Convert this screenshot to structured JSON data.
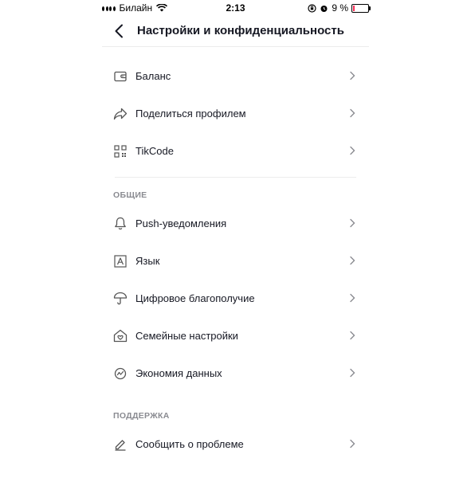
{
  "status_bar": {
    "carrier": "Билайн",
    "time": "2:13",
    "battery": "9 %",
    "battery_color": "#fe2c55"
  },
  "header": {
    "title": "Настройки и конфиденциальность",
    "back_icon": "chevron-left-icon"
  },
  "account_items": [
    {
      "label": "Баланс",
      "icon": "wallet-icon"
    },
    {
      "label": "Поделиться профилем",
      "icon": "share-icon"
    },
    {
      "label": "TikCode",
      "icon": "qr-code-icon"
    }
  ],
  "general": {
    "title": "ОБЩИЕ",
    "items": [
      {
        "label": "Push-уведомления",
        "icon": "bell-icon"
      },
      {
        "label": "Язык",
        "icon": "language-icon"
      },
      {
        "label": "Цифровое благополучие",
        "icon": "umbrella-icon"
      },
      {
        "label": "Семейные настройки",
        "icon": "family-home-icon"
      },
      {
        "label": "Экономия данных",
        "icon": "data-saver-icon"
      }
    ]
  },
  "support": {
    "title": "ПОДДЕРЖКА",
    "items": [
      {
        "label": "Сообщить о проблеме",
        "icon": "pencil-icon"
      }
    ]
  }
}
